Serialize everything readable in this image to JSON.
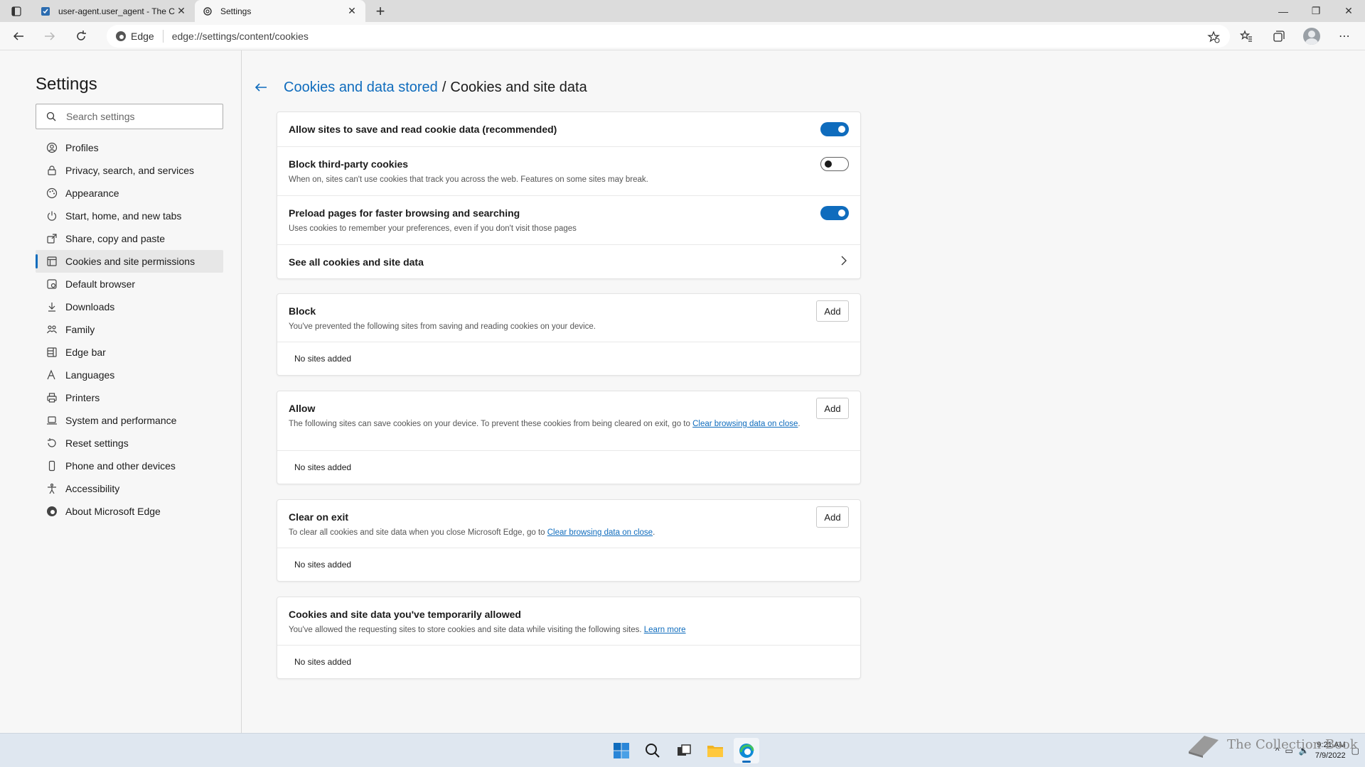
{
  "tabs": [
    {
      "title": "user-agent.user_agent - The Col",
      "active": false,
      "icon": "document-icon"
    },
    {
      "title": "Settings",
      "active": true,
      "icon": "gear-icon"
    }
  ],
  "address": {
    "badge": "Edge",
    "url": "edge://settings/content/cookies"
  },
  "sidebar": {
    "title": "Settings",
    "search_placeholder": "Search settings",
    "items": [
      {
        "label": "Profiles",
        "icon": "profile-icon"
      },
      {
        "label": "Privacy, search, and services",
        "icon": "lock-icon"
      },
      {
        "label": "Appearance",
        "icon": "appearance-icon"
      },
      {
        "label": "Start, home, and new tabs",
        "icon": "power-icon"
      },
      {
        "label": "Share, copy and paste",
        "icon": "share-icon"
      },
      {
        "label": "Cookies and site permissions",
        "icon": "cookies-icon",
        "selected": true
      },
      {
        "label": "Default browser",
        "icon": "browser-icon"
      },
      {
        "label": "Downloads",
        "icon": "download-icon"
      },
      {
        "label": "Family",
        "icon": "family-icon"
      },
      {
        "label": "Edge bar",
        "icon": "edge-bar-icon"
      },
      {
        "label": "Languages",
        "icon": "language-icon"
      },
      {
        "label": "Printers",
        "icon": "printer-icon"
      },
      {
        "label": "System and performance",
        "icon": "laptop-icon"
      },
      {
        "label": "Reset settings",
        "icon": "reset-icon"
      },
      {
        "label": "Phone and other devices",
        "icon": "phone-icon"
      },
      {
        "label": "Accessibility",
        "icon": "accessibility-icon"
      },
      {
        "label": "About Microsoft Edge",
        "icon": "edge-logo-icon"
      }
    ]
  },
  "breadcrumb": {
    "parent": "Cookies and data stored",
    "separator": "/",
    "current": "Cookies and site data"
  },
  "settings": {
    "allow_cookies": {
      "title": "Allow sites to save and read cookie data (recommended)",
      "enabled": true
    },
    "block_third_party": {
      "title": "Block third-party cookies",
      "desc": "When on, sites can't use cookies that track you across the web. Features on some sites may break.",
      "enabled": false
    },
    "preload": {
      "title": "Preload pages for faster browsing and searching",
      "desc": "Uses cookies to remember your preferences, even if you don't visit those pages",
      "enabled": true
    },
    "see_all": {
      "title": "See all cookies and site data"
    }
  },
  "lists": {
    "block": {
      "title": "Block",
      "desc": "You've prevented the following sites from saving and reading cookies on your device.",
      "add": "Add",
      "empty": "No sites added"
    },
    "allow": {
      "title": "Allow",
      "desc_pre": "The following sites can save cookies on your device. To prevent these cookies from being cleared on exit, go to",
      "link": "Clear browsing data on close",
      "desc_post": ".",
      "add": "Add",
      "empty": "No sites added"
    },
    "clear_on_exit": {
      "title": "Clear on exit",
      "desc_pre": "To clear all cookies and site data when you close Microsoft Edge, go to",
      "link": "Clear browsing data on close",
      "desc_post": ".",
      "add": "Add",
      "empty": "No sites added"
    },
    "temp_allowed": {
      "title": "Cookies and site data you've temporarily allowed",
      "desc_pre": "You've allowed the requesting sites to store cookies and site data while visiting the following sites.",
      "link": "Learn more",
      "empty": "No sites added"
    }
  },
  "taskbar": {
    "time": "9:21 AM",
    "date": "7/9/2022"
  },
  "watermark": "The Collection Book",
  "colors": {
    "accent": "#0f6cbd",
    "taskbar": "#dfe7f0"
  }
}
